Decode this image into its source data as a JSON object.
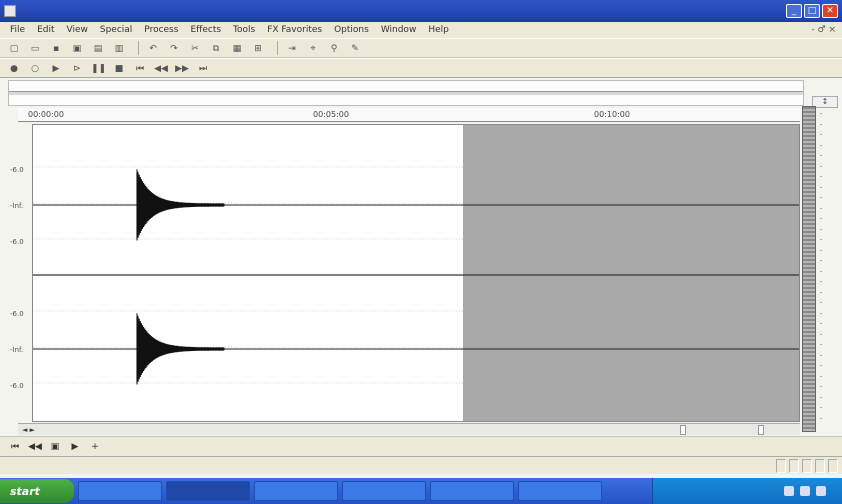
{
  "window": {
    "title": "",
    "min": "_",
    "max": "□",
    "close": "✕"
  },
  "menu": {
    "items": [
      "File",
      "Edit",
      "View",
      "Special",
      "Process",
      "Effects",
      "Tools",
      "FX Favorites",
      "Options",
      "Window",
      "Help"
    ],
    "right": "- ♂ ×"
  },
  "toolbar": {
    "icons": [
      "new-icon",
      "open-icon",
      "save-icon",
      "save-as-icon",
      "print-icon",
      "print-preview-icon",
      "undo-icon",
      "redo-icon",
      "cut-icon",
      "copy-icon",
      "paste-icon",
      "mix-icon",
      "trim-icon",
      "tool-icon",
      "zoom-icon",
      "pencil-icon"
    ]
  },
  "toolbar2": {
    "icons": [
      "record-icon",
      "loop-icon",
      "play-icon",
      "play-cursor-icon",
      "pause-icon",
      "stop-icon",
      "go-start-icon",
      "rewind-icon",
      "forward-icon",
      "go-end-icon"
    ]
  },
  "ruler": {
    "ticks": [
      "00:00:00",
      "00:05:00",
      "00:10:00"
    ]
  },
  "db_labels": {
    "top": [
      "-6.0",
      "-Inf.",
      "-6.0"
    ],
    "bottom": [
      "-6.0",
      "-Inf.",
      "-6.0"
    ]
  },
  "hscroll": {
    "left": "◄ ►",
    "zoom_a": "",
    "zoom_b": ""
  },
  "transport": {
    "rate": "",
    "position": ""
  },
  "selection": {
    "range": ""
  },
  "status": {
    "cells": [
      "",
      "",
      "",
      "",
      ""
    ]
  },
  "taskbar": {
    "start": "start",
    "tasks": [
      "",
      "",
      "",
      "",
      "",
      ""
    ],
    "clock": ""
  },
  "waveform": {
    "selection_start_fraction": 0.56,
    "events": [
      {
        "channel": "top",
        "center_fraction_y": 0.27,
        "x_fraction": 0.14
      },
      {
        "channel": "bottom",
        "center_fraction_y": 0.75,
        "x_fraction": 0.14
      }
    ]
  }
}
